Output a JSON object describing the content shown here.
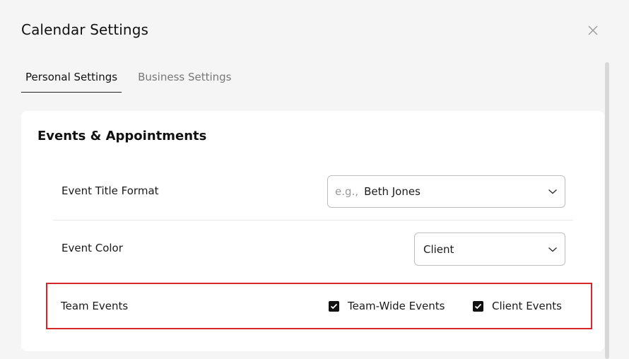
{
  "dialog": {
    "title": "Calendar Settings"
  },
  "tabs": [
    {
      "label": "Personal Settings",
      "active": true
    },
    {
      "label": "Business Settings",
      "active": false
    }
  ],
  "section": {
    "title": "Events & Appointments",
    "event_title_format": {
      "label": "Event Title Format",
      "prefix": "e.g.,",
      "value": "Beth Jones"
    },
    "event_color": {
      "label": "Event Color",
      "value": "Client"
    },
    "team_events": {
      "label": "Team Events",
      "options": [
        {
          "label": "Team-Wide Events",
          "checked": true
        },
        {
          "label": "Client Events",
          "checked": true
        }
      ]
    }
  },
  "colors": {
    "highlight": "#d62728",
    "background": "#f5f5f5",
    "card": "#ffffff"
  }
}
